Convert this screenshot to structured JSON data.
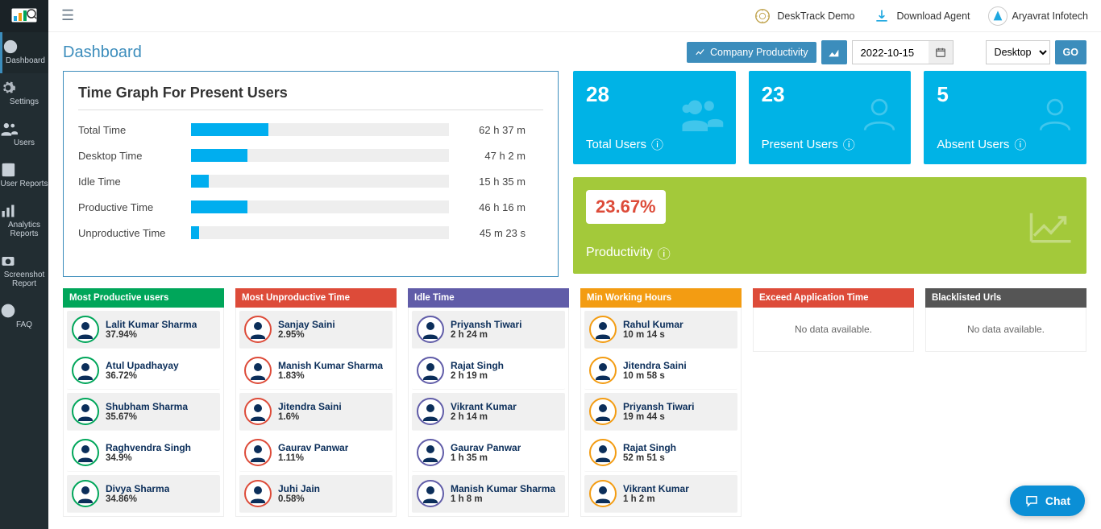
{
  "header": {
    "demo": "DeskTrack Demo",
    "download": "Download Agent",
    "company": "Aryavrat Infotech"
  },
  "sidebar": [
    {
      "label": "Dashboard"
    },
    {
      "label": "Settings"
    },
    {
      "label": "Users"
    },
    {
      "label": "User Reports"
    },
    {
      "label": "Analytics\nReports"
    },
    {
      "label": "Screenshot\nReport"
    },
    {
      "label": "FAQ"
    }
  ],
  "page": {
    "title": "Dashboard",
    "company_btn": "Company Productivity",
    "date": "2022-10-15",
    "view_select": "Desktop",
    "go": "GO"
  },
  "time_graph": {
    "title": "Time Graph For Present Users",
    "rows": [
      {
        "label": "Total Time",
        "value": "62 h 37 m",
        "pct": 30
      },
      {
        "label": "Desktop Time",
        "value": "47 h 2 m",
        "pct": 22
      },
      {
        "label": "Idle Time",
        "value": "15 h 35 m",
        "pct": 7
      },
      {
        "label": "Productive Time",
        "value": "46 h 16 m",
        "pct": 22
      },
      {
        "label": "Unproductive Time",
        "value": "45 m 23 s",
        "pct": 3
      }
    ]
  },
  "chart_data": {
    "type": "bar",
    "title": "Time Graph For Present Users",
    "orientation": "horizontal",
    "categories": [
      "Total Time",
      "Desktop Time",
      "Idle Time",
      "Productive Time",
      "Unproductive Time"
    ],
    "values_label": [
      "62 h 37 m",
      "47 h 2 m",
      "15 h 35 m",
      "46 h 16 m",
      "45 m 23 s"
    ],
    "values_seconds": [
      225420,
      169320,
      56100,
      166560,
      2723
    ]
  },
  "stats": {
    "total": {
      "num": "28",
      "label": "Total Users"
    },
    "present": {
      "num": "23",
      "label": "Present Users"
    },
    "absent": {
      "num": "5",
      "label": "Absent Users"
    }
  },
  "productivity": {
    "value": "23.67%",
    "label": "Productivity"
  },
  "cards": [
    {
      "title": "Most Productive users",
      "color": "green",
      "ring": "green",
      "items": [
        {
          "name": "Lalit Kumar Sharma",
          "val": "37.94%"
        },
        {
          "name": "Atul Upadhayay",
          "val": "36.72%"
        },
        {
          "name": "Shubham Sharma",
          "val": "35.67%"
        },
        {
          "name": "Raghvendra Singh",
          "val": "34.9%"
        },
        {
          "name": "Divya Sharma",
          "val": "34.86%"
        }
      ]
    },
    {
      "title": "Most Unproductive Time",
      "color": "red",
      "ring": "red",
      "items": [
        {
          "name": "Sanjay Saini",
          "val": "2.95%"
        },
        {
          "name": "Manish Kumar Sharma",
          "val": "1.83%"
        },
        {
          "name": "Jitendra Saini",
          "val": "1.6%"
        },
        {
          "name": "Gaurav Panwar",
          "val": "1.11%"
        },
        {
          "name": "Juhi Jain",
          "val": "0.58%"
        }
      ]
    },
    {
      "title": "Idle Time",
      "color": "purple",
      "ring": "purple",
      "items": [
        {
          "name": "Priyansh Tiwari",
          "val": "2 h 24 m"
        },
        {
          "name": "Rajat Singh",
          "val": "2 h 19 m"
        },
        {
          "name": "Vikrant Kumar",
          "val": "2 h 14 m"
        },
        {
          "name": "Gaurav Panwar",
          "val": "1 h 35 m"
        },
        {
          "name": "Manish Kumar Sharma",
          "val": "1 h 8 m"
        }
      ]
    },
    {
      "title": "Min Working Hours",
      "color": "yellow",
      "ring": "yellow",
      "items": [
        {
          "name": "Rahul Kumar",
          "val": "10 m 14 s"
        },
        {
          "name": "Jitendra Saini",
          "val": "10 m 58 s"
        },
        {
          "name": "Priyansh Tiwari",
          "val": "19 m 44 s"
        },
        {
          "name": "Rajat Singh",
          "val": "52 m 51 s"
        },
        {
          "name": "Vikrant Kumar",
          "val": "1 h 2 m"
        }
      ]
    },
    {
      "title": "Exceed Application Time",
      "color": "red",
      "empty": "No data available."
    },
    {
      "title": "Blacklisted Urls",
      "color": "dark",
      "empty": "No data available."
    }
  ],
  "chat": "Chat"
}
